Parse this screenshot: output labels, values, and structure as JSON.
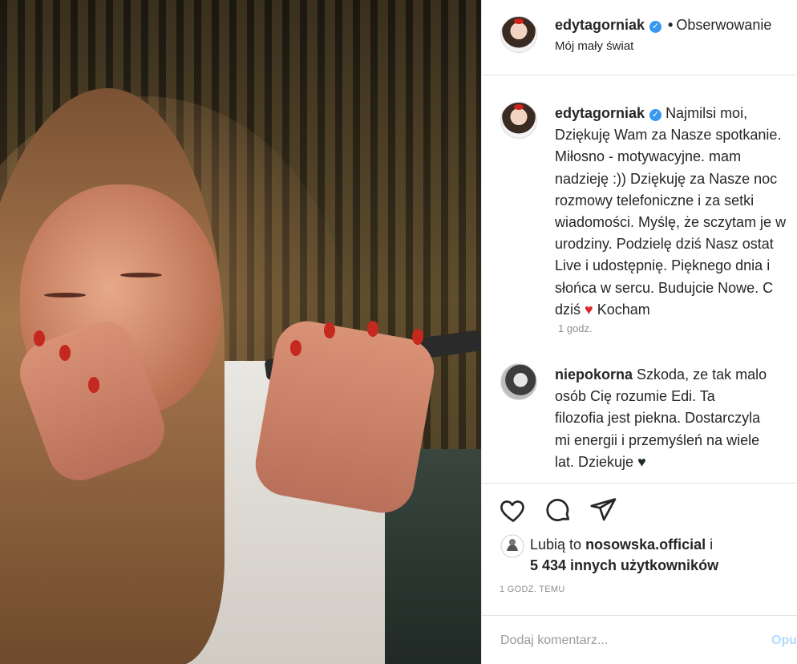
{
  "post": {
    "username": "edytagorniak",
    "follow_label": "Obserwowanie",
    "location": "Mój mały świat",
    "caption_lines": [
      "Najmilsi moi,",
      "Dziękuję Wam za Nasze spotkanie.",
      "Miłosno - motywacyjne. mam",
      "nadzieję :)) Dziękuję za Nasze noc",
      "rozmowy telefoniczne i za setki",
      "wiadomości. Myślę, że sczytam je w",
      "urodziny. Podzielę dziś Nasz ostat",
      "Live i udostępnię. Pięknego dnia i",
      "słońca w sercu. Budujcie Nowe. C",
      "dziś",
      "Kocham"
    ],
    "caption_time": "1 godz."
  },
  "comment": {
    "username": "niepokorna",
    "lines": [
      "Szkoda, ze tak malo",
      "osób Cię rozumie Edi. Ta",
      "filozofia jest piekna. Dostarczyla",
      "mi energii i przemyśleń na wiele",
      "lat. Dziekuje"
    ]
  },
  "likes": {
    "prefix": "Lubią to ",
    "user": "nosowska.official",
    "suffix": " i",
    "count_line": "5 434 innych użytkowników"
  },
  "time_ago": "1 GODZ. TEMU",
  "comment_box": {
    "placeholder": "Dodaj komentarz...",
    "post_label": "Opu"
  },
  "icons": [
    "verified-badge-icon",
    "heart-icon",
    "comment-icon",
    "share-icon",
    "liker-avatar-icon"
  ],
  "colors": {
    "verified": "#3897f0",
    "heart": "#e0262b",
    "post_button": "#b3dbff",
    "meta": "#8e8e8e"
  }
}
